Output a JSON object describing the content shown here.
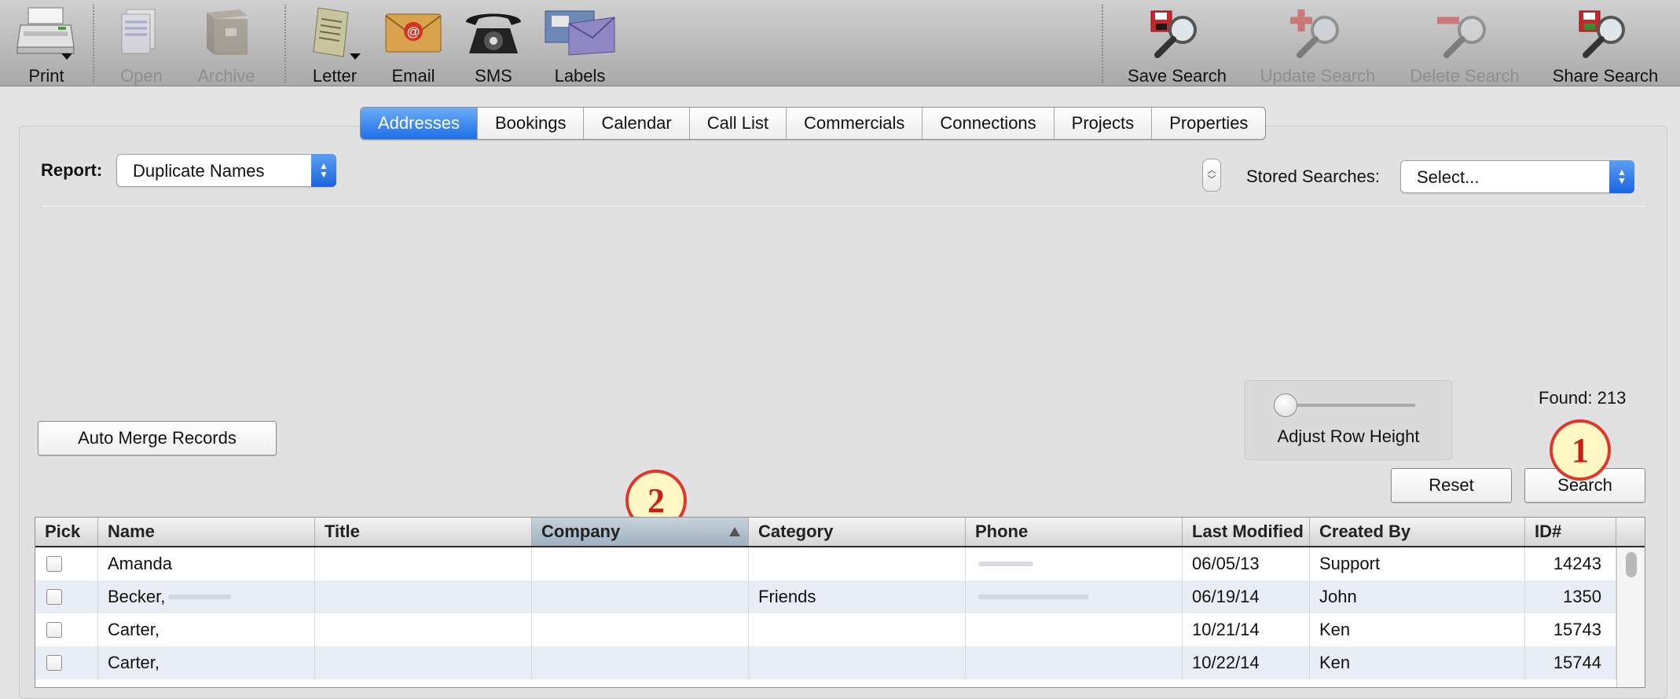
{
  "toolbar": {
    "print": "Print",
    "open": "Open",
    "archive": "Archive",
    "letter": "Letter",
    "email": "Email",
    "sms": "SMS",
    "labels": "Labels",
    "save_search": "Save Search",
    "update_search": "Update Search",
    "delete_search": "Delete Search",
    "share_search": "Share Search",
    "email_icon_glyph": "@"
  },
  "tabs": [
    "Addresses",
    "Bookings",
    "Calendar",
    "Call List",
    "Commercials",
    "Connections",
    "Projects",
    "Properties"
  ],
  "active_tab": "Addresses",
  "report": {
    "label": "Report:",
    "value": "Duplicate Names"
  },
  "stored_searches": {
    "label": "Stored Searches:",
    "value": "Select..."
  },
  "found": "Found: 213",
  "auto_merge": "Auto Merge Records",
  "adjust_row_height": "Adjust Row Height",
  "reset": "Reset",
  "search": "Search",
  "callouts": [
    "1",
    "2"
  ],
  "table": {
    "columns": [
      "Pick",
      "Name",
      "Title",
      "Company",
      "Category",
      "Phone",
      "Last Modified",
      "Created By",
      "ID#"
    ],
    "sorted_column": "Company",
    "rows": [
      {
        "name": "Amanda",
        "title": "",
        "company": "",
        "category": "",
        "phone": "",
        "modified": "06/05/13",
        "created_by": "Support",
        "id": "14243"
      },
      {
        "name": "Becker,",
        "title": "",
        "company": "",
        "category": "Friends",
        "phone": "",
        "modified": "06/19/14",
        "created_by": "John",
        "id": "1350"
      },
      {
        "name": "Carter,",
        "title": "",
        "company": "",
        "category": "",
        "phone": "",
        "modified": "10/21/14",
        "created_by": "Ken",
        "id": "15743"
      },
      {
        "name": "Carter,",
        "title": "",
        "company": "",
        "category": "",
        "phone": "",
        "modified": "10/22/14",
        "created_by": "Ken",
        "id": "15744"
      }
    ]
  },
  "colors": {
    "accent": "#1e6fe8",
    "callout_border": "#e0372b",
    "callout_fill": "#fff7c4"
  }
}
